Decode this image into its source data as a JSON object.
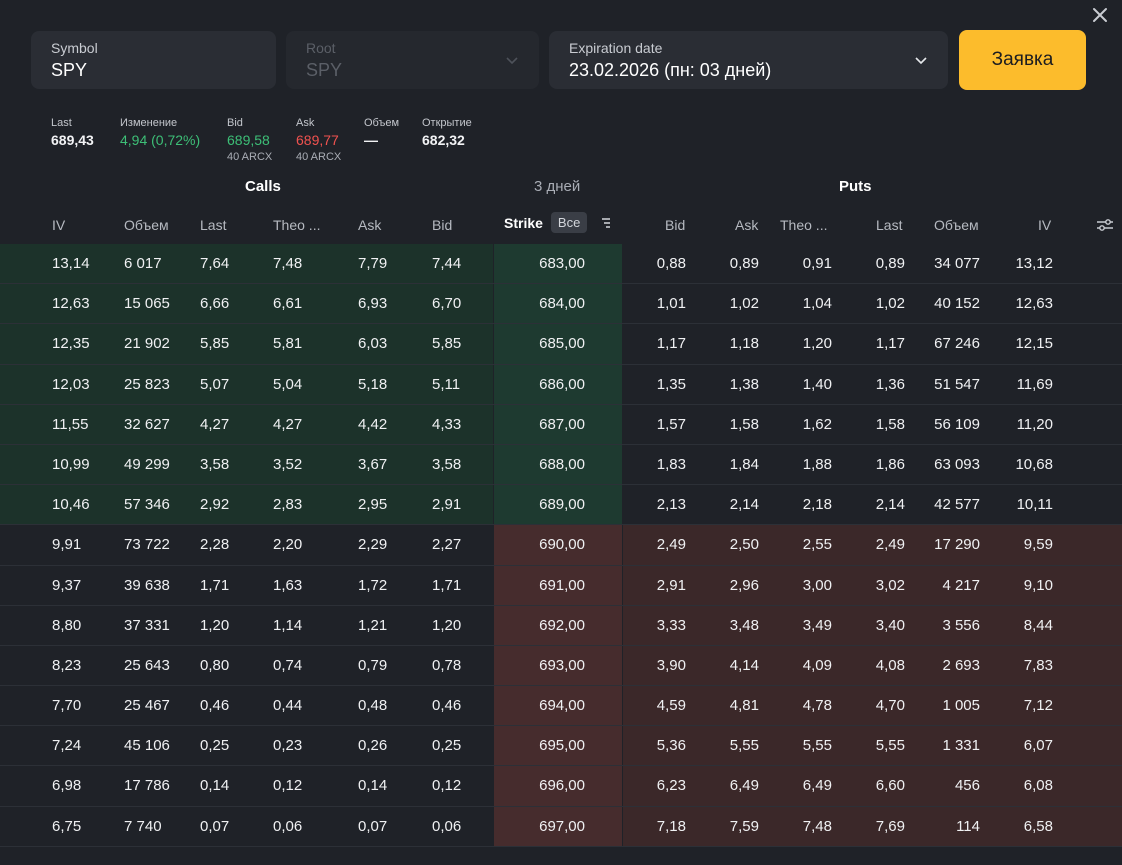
{
  "form": {
    "symbol": {
      "label": "Symbol",
      "value": "SPY"
    },
    "root": {
      "label": "Root",
      "value": "SPY"
    },
    "expiration": {
      "label": "Expiration date",
      "value": "23.02.2026 (пн: 03 дней)"
    },
    "order_button": "Заявка"
  },
  "quote": {
    "last": {
      "label": "Last",
      "value": "689,43"
    },
    "change": {
      "label": "Изменение",
      "value": "4,94 (0,72%)"
    },
    "bid": {
      "label": "Bid",
      "value": "689,58",
      "size": "40 ARCX"
    },
    "ask": {
      "label": "Ask",
      "value": "689,77",
      "size": "40 ARCX"
    },
    "volume": {
      "label": "Объем",
      "value": "—"
    },
    "open": {
      "label": "Открытие",
      "value": "682,32"
    }
  },
  "sections": {
    "calls": "Calls",
    "days": "3 дней",
    "puts": "Puts"
  },
  "columns": {
    "calls": [
      "IV",
      "Объем",
      "Last",
      "Theo ...",
      "Ask",
      "Bid"
    ],
    "strike": "Strike",
    "strike_filter": "Все",
    "puts": [
      "Bid",
      "Ask",
      "Theo ...",
      "Last",
      "Объем",
      "IV"
    ]
  },
  "colors": {
    "accent": "#fcbc2c",
    "positive": "#3dbf77",
    "negative": "#f0524f",
    "itm_calls": "#1c322a",
    "itm_puts": "#3b2829"
  },
  "icons": {
    "close": "close-icon",
    "chevron": "chevron-down-icon",
    "sort": "sort-icon",
    "settings": "settings-sliders-icon"
  },
  "rows": [
    {
      "calls": [
        "13,14",
        "6 017",
        "7,64",
        "7,48",
        "7,79",
        "7,44"
      ],
      "strike": "683,00",
      "puts": [
        "0,88",
        "0,89",
        "0,91",
        "0,89",
        "34 077",
        "13,12"
      ],
      "itm": "calls"
    },
    {
      "calls": [
        "12,63",
        "15 065",
        "6,66",
        "6,61",
        "6,93",
        "6,70"
      ],
      "strike": "684,00",
      "puts": [
        "1,01",
        "1,02",
        "1,04",
        "1,02",
        "40 152",
        "12,63"
      ],
      "itm": "calls"
    },
    {
      "calls": [
        "12,35",
        "21 902",
        "5,85",
        "5,81",
        "6,03",
        "5,85"
      ],
      "strike": "685,00",
      "puts": [
        "1,17",
        "1,18",
        "1,20",
        "1,17",
        "67 246",
        "12,15"
      ],
      "itm": "calls"
    },
    {
      "calls": [
        "12,03",
        "25 823",
        "5,07",
        "5,04",
        "5,18",
        "5,11"
      ],
      "strike": "686,00",
      "puts": [
        "1,35",
        "1,38",
        "1,40",
        "1,36",
        "51 547",
        "11,69"
      ],
      "itm": "calls"
    },
    {
      "calls": [
        "11,55",
        "32 627",
        "4,27",
        "4,27",
        "4,42",
        "4,33"
      ],
      "strike": "687,00",
      "puts": [
        "1,57",
        "1,58",
        "1,62",
        "1,58",
        "56 109",
        "11,20"
      ],
      "itm": "calls"
    },
    {
      "calls": [
        "10,99",
        "49 299",
        "3,58",
        "3,52",
        "3,67",
        "3,58"
      ],
      "strike": "688,00",
      "puts": [
        "1,83",
        "1,84",
        "1,88",
        "1,86",
        "63 093",
        "10,68"
      ],
      "itm": "calls"
    },
    {
      "calls": [
        "10,46",
        "57 346",
        "2,92",
        "2,83",
        "2,95",
        "2,91"
      ],
      "strike": "689,00",
      "puts": [
        "2,13",
        "2,14",
        "2,18",
        "2,14",
        "42 577",
        "10,11"
      ],
      "itm": "calls"
    },
    {
      "calls": [
        "9,91",
        "73 722",
        "2,28",
        "2,20",
        "2,29",
        "2,27"
      ],
      "strike": "690,00",
      "puts": [
        "2,49",
        "2,50",
        "2,55",
        "2,49",
        "17 290",
        "9,59"
      ],
      "itm": "puts"
    },
    {
      "calls": [
        "9,37",
        "39 638",
        "1,71",
        "1,63",
        "1,72",
        "1,71"
      ],
      "strike": "691,00",
      "puts": [
        "2,91",
        "2,96",
        "3,00",
        "3,02",
        "4 217",
        "9,10"
      ],
      "itm": "puts"
    },
    {
      "calls": [
        "8,80",
        "37 331",
        "1,20",
        "1,14",
        "1,21",
        "1,20"
      ],
      "strike": "692,00",
      "puts": [
        "3,33",
        "3,48",
        "3,49",
        "3,40",
        "3 556",
        "8,44"
      ],
      "itm": "puts"
    },
    {
      "calls": [
        "8,23",
        "25 643",
        "0,80",
        "0,74",
        "0,79",
        "0,78"
      ],
      "strike": "693,00",
      "puts": [
        "3,90",
        "4,14",
        "4,09",
        "4,08",
        "2 693",
        "7,83"
      ],
      "itm": "puts"
    },
    {
      "calls": [
        "7,70",
        "25 467",
        "0,46",
        "0,44",
        "0,48",
        "0,46"
      ],
      "strike": "694,00",
      "puts": [
        "4,59",
        "4,81",
        "4,78",
        "4,70",
        "1 005",
        "7,12"
      ],
      "itm": "puts"
    },
    {
      "calls": [
        "7,24",
        "45 106",
        "0,25",
        "0,23",
        "0,26",
        "0,25"
      ],
      "strike": "695,00",
      "puts": [
        "5,36",
        "5,55",
        "5,55",
        "5,55",
        "1 331",
        "6,07"
      ],
      "itm": "puts"
    },
    {
      "calls": [
        "6,98",
        "17 786",
        "0,14",
        "0,12",
        "0,14",
        "0,12"
      ],
      "strike": "696,00",
      "puts": [
        "6,23",
        "6,49",
        "6,49",
        "6,60",
        "456",
        "6,08"
      ],
      "itm": "puts"
    },
    {
      "calls": [
        "6,75",
        "7 740",
        "0,07",
        "0,06",
        "0,07",
        "0,06"
      ],
      "strike": "697,00",
      "puts": [
        "7,18",
        "7,59",
        "7,48",
        "7,69",
        "114",
        "6,58"
      ],
      "itm": "puts"
    }
  ]
}
